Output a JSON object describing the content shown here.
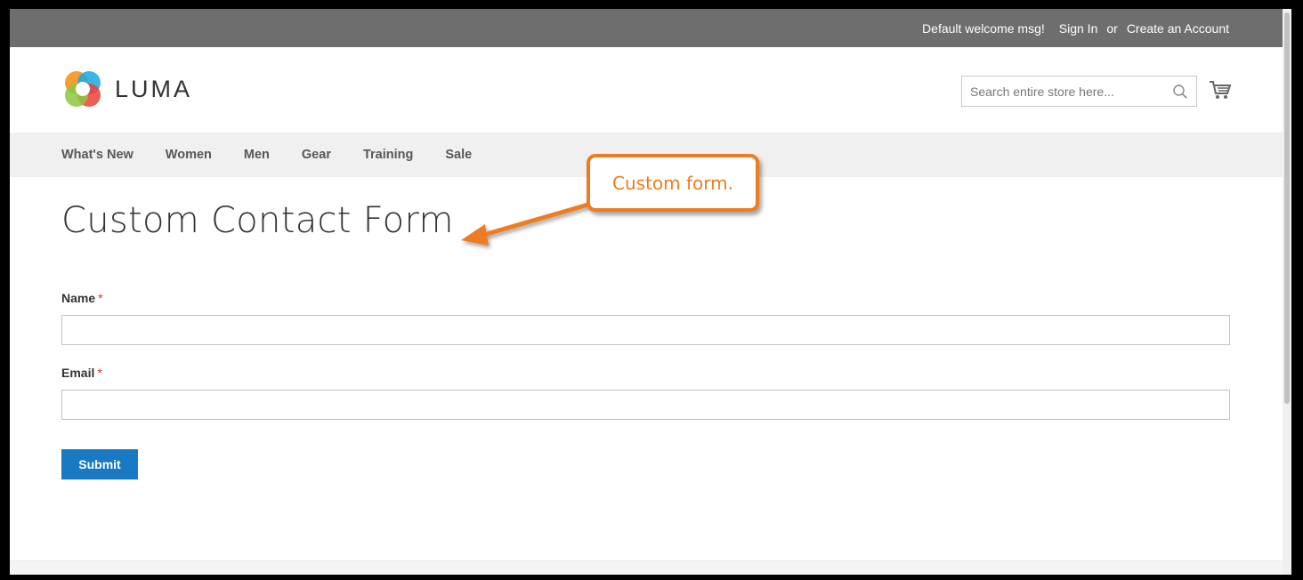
{
  "topbar": {
    "welcome": "Default welcome msg!",
    "sign_in": "Sign In",
    "or": "or",
    "create_account": "Create an Account"
  },
  "header": {
    "logo_text": "LUMA",
    "search_placeholder": "Search entire store here..."
  },
  "nav": {
    "items": [
      "What's New",
      "Women",
      "Men",
      "Gear",
      "Training",
      "Sale"
    ]
  },
  "page": {
    "title": "Custom Contact Form"
  },
  "form": {
    "name_label": "Name",
    "email_label": "Email",
    "required_marker": "*",
    "name_value": "",
    "email_value": "",
    "submit_label": "Submit"
  },
  "annotation": {
    "callout_text": "Custom form."
  },
  "icons": {
    "search": "search-icon",
    "cart": "cart-icon",
    "logo": "luma-logo-icon"
  },
  "colors": {
    "topbar_bg": "#6e6e6e",
    "nav_bg": "#f0f0f0",
    "primary_button": "#1979c3",
    "required": "#e02b27",
    "callout": "#ee7d22"
  }
}
